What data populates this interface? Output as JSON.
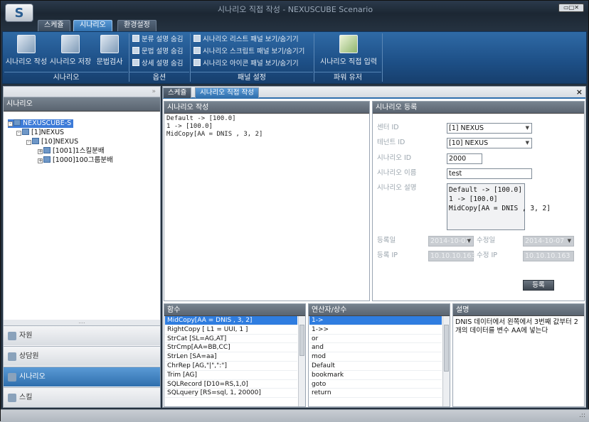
{
  "window": {
    "title": "시나리오 직접 작성 - NEXUSCUBE Scenario",
    "logo": "S",
    "controls": "▭□✕"
  },
  "ribbon_tabs": [
    "스케쥴",
    "시나리오",
    "환경설정"
  ],
  "ribbon": {
    "big_buttons": [
      {
        "label": "시나리오 작성",
        "icon": "doc-icon"
      },
      {
        "label": "시나리오 저장",
        "icon": "save-icon"
      },
      {
        "label": "문법검사",
        "icon": "check-icon"
      },
      {
        "label": "시나리오 직접 입력",
        "icon": "edit-icon"
      }
    ],
    "options": [
      "분류 설명 숨김",
      "문법 설명 숨김",
      "상세 설명 숨김"
    ],
    "panel_settings": [
      "시나리오 리스트 패널 보기/숨기기",
      "시나리오 스크립트 패널 보기/숨기기",
      "시나리오 아이콘 패널 보기/숨기기"
    ],
    "groups": [
      "시나리오",
      "옵션",
      "패널 설정",
      "파워 유저"
    ]
  },
  "left": {
    "search_button": "»",
    "header": "시나리오",
    "tree": [
      {
        "label": "NEXUSCUBE-S",
        "selected": true
      },
      {
        "label": "[1]NEXUS"
      },
      {
        "label": "[10]NEXUS"
      },
      {
        "label": "[1001]1스킬분배"
      },
      {
        "label": "[1000]100그룹분배"
      }
    ],
    "splitter": "....",
    "nav": [
      "자원",
      "상담원",
      "시나리오",
      "스킬"
    ]
  },
  "doc_tabs": [
    "스케쥴",
    "시나리오 직접 작성"
  ],
  "close_glyph": "×",
  "editor": {
    "header": "시나리오 작성",
    "content": "Default -> [100.0]\n1 -> [100.0]\nMidCopy[AA = DNIS , 3, 2]"
  },
  "register": {
    "header": "시나리오 등록",
    "center_id_label": "센터 ID",
    "center_id": "[1] NEXUS",
    "tenant_id_label": "테넌트 ID",
    "tenant_id": "[10] NEXUS",
    "scenario_id_label": "시나리오 ID",
    "scenario_id": "2000",
    "scenario_name_label": "시나리오 이름",
    "scenario_name": "test",
    "scenario_desc_label": "시나리오 설명",
    "scenario_desc": "Default -> [100.0]\n1 -> [100.0]\nMidCopy[AA = DNIS , 3, 2]",
    "reg_date_label": "등록일",
    "reg_date": "2014-10-07",
    "mod_date_label": "수정일",
    "mod_date": "2014-10-07",
    "reg_ip_label": "등록 IP",
    "reg_ip": "10.10.10.163",
    "mod_ip_label": "수정 IP",
    "mod_ip": "10.10.10.163",
    "submit": "등록",
    "dropdown_glyph": "▼"
  },
  "functions": {
    "header": "함수",
    "items": [
      "MidCopy[AA = DNIS , 3, 2]",
      "RightCopy [ L1 = UUI, 1 ]",
      "StrCat [SL=AG,AT]",
      "StrCmp[AA=BB,CC]",
      "StrLen [SA=aa]",
      "ChrRep [AG,\"|\",\":\"]",
      "Trim [AG]",
      "SQLRecord [D10=RS,1,0]",
      "SQLquery [RS=sql, 1, 20000]"
    ]
  },
  "operators": {
    "header": "연산자/상수",
    "items": [
      "1->",
      "1->>",
      "or",
      "and",
      "mod",
      "Default",
      "bookmark",
      "goto",
      "return"
    ]
  },
  "description": {
    "header": "설명",
    "text": "DNIS 데이터에서 왼쪽에서 3번째 값부터 2개의 데이터를 변수 AA에 넣는다"
  },
  "status": {
    "grip": ".::"
  }
}
